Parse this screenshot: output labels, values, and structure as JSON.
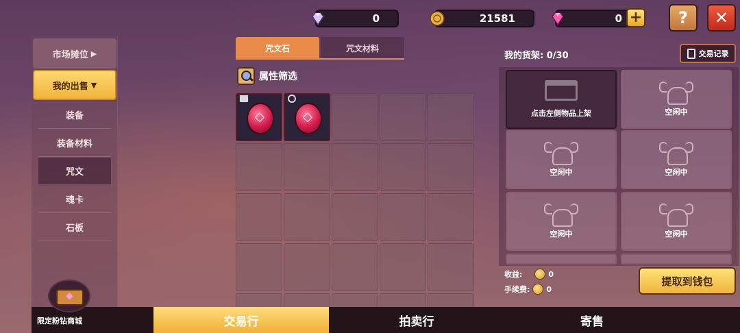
{
  "currencies": {
    "diamond": {
      "value": "0",
      "icon": "diamond-icon"
    },
    "gold": {
      "value": "21581",
      "icon": "gold-coin-icon"
    },
    "pink_diamond": {
      "value": "0",
      "icon": "pink-diamond-icon",
      "plus": "+"
    }
  },
  "top_buttons": {
    "help": "?",
    "close": "✕"
  },
  "sidebar": {
    "market": "市场摊位",
    "market_arrow": "▶",
    "mysell": "我的出售",
    "mysell_arrow": "▼",
    "items": [
      {
        "label": "装备"
      },
      {
        "label": "装备材料"
      },
      {
        "label": "咒文"
      },
      {
        "label": "魂卡"
      },
      {
        "label": "石板"
      }
    ]
  },
  "tabs": [
    {
      "label": "咒文石"
    },
    {
      "label": "咒文材料"
    }
  ],
  "filter_label": "属性筛选",
  "inventory": {
    "rows": 5,
    "cols": 5,
    "filled": 2
  },
  "shelf": {
    "title": "我的货架: 0/30",
    "record_label": "交易记录",
    "first_slot_label": "点击左侧物品上架",
    "idle_label": "空闲中"
  },
  "income": {
    "label": "收益:",
    "value": "0"
  },
  "fee": {
    "label": "手续费:",
    "value": "0"
  },
  "withdraw_label": "提取到钱包",
  "shop_label": "限定粉钻商城",
  "bottom_nav": [
    "交易行",
    "拍卖行",
    "寄售"
  ],
  "colors": {
    "accent": "#e88a48",
    "gold": "#f2b03a",
    "close_red": "#d83a2a"
  }
}
